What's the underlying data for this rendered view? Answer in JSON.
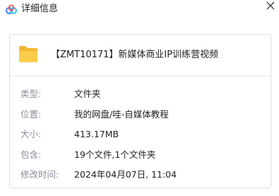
{
  "window": {
    "title": "详细信息",
    "app_icon": "cloud-icon",
    "close_icon": "close-icon"
  },
  "file": {
    "icon": "folder-icon",
    "name": "【ZMT10171】新媒体商业IP训练营视频"
  },
  "details": [
    {
      "label": "类型:",
      "value": "文件夹"
    },
    {
      "label": "位置:",
      "value": "我的网盘/哇-自媒体教程"
    },
    {
      "label": "大小:",
      "value": "413.17MB"
    },
    {
      "label": "包含:",
      "value": "19个文件,1个文件夹"
    },
    {
      "label": "修改时间:",
      "value": "2024年04月07日, 11:04"
    }
  ],
  "colors": {
    "folder": "#f5c13c",
    "cloud_accent": "#3b7cf5",
    "label": "#8a8f99",
    "value": "#222222"
  }
}
